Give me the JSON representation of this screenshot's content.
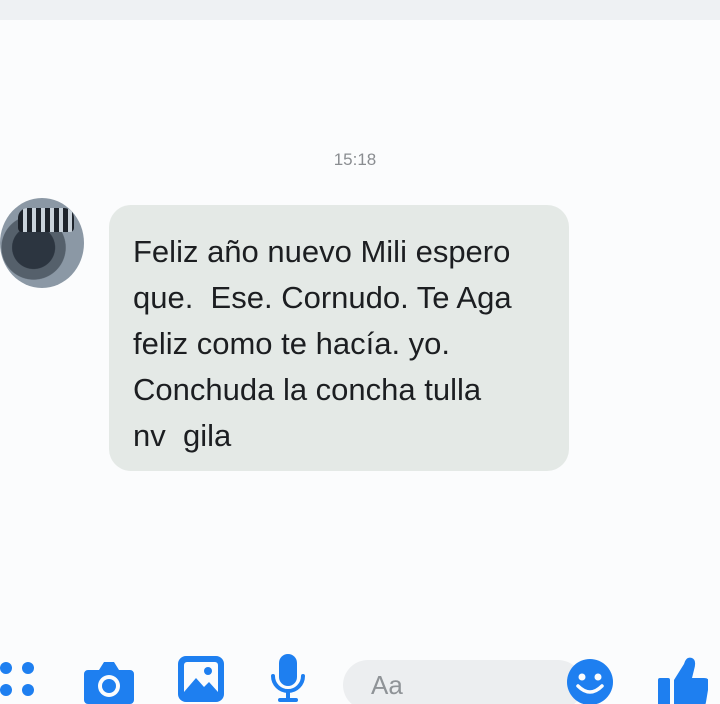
{
  "conversation": {
    "timestamp": "15:18",
    "message": "Feliz año nuevo Mili espero\nque.  Ese. Cornudo. Te Aga\nfeliz como te hacía. yo.\nConchuda la concha tulla\nnv  gila"
  },
  "composer": {
    "placeholder": "Aa",
    "icons": [
      "more-options-icon",
      "camera-icon",
      "photo-icon",
      "microphone-icon",
      "emoji-icon",
      "thumbs-up-icon"
    ]
  },
  "colors": {
    "accent": "#1e7ff0",
    "bubble": "#e4e9e6",
    "background": "#fbfcfd",
    "timestamp": "#8a8d91"
  }
}
